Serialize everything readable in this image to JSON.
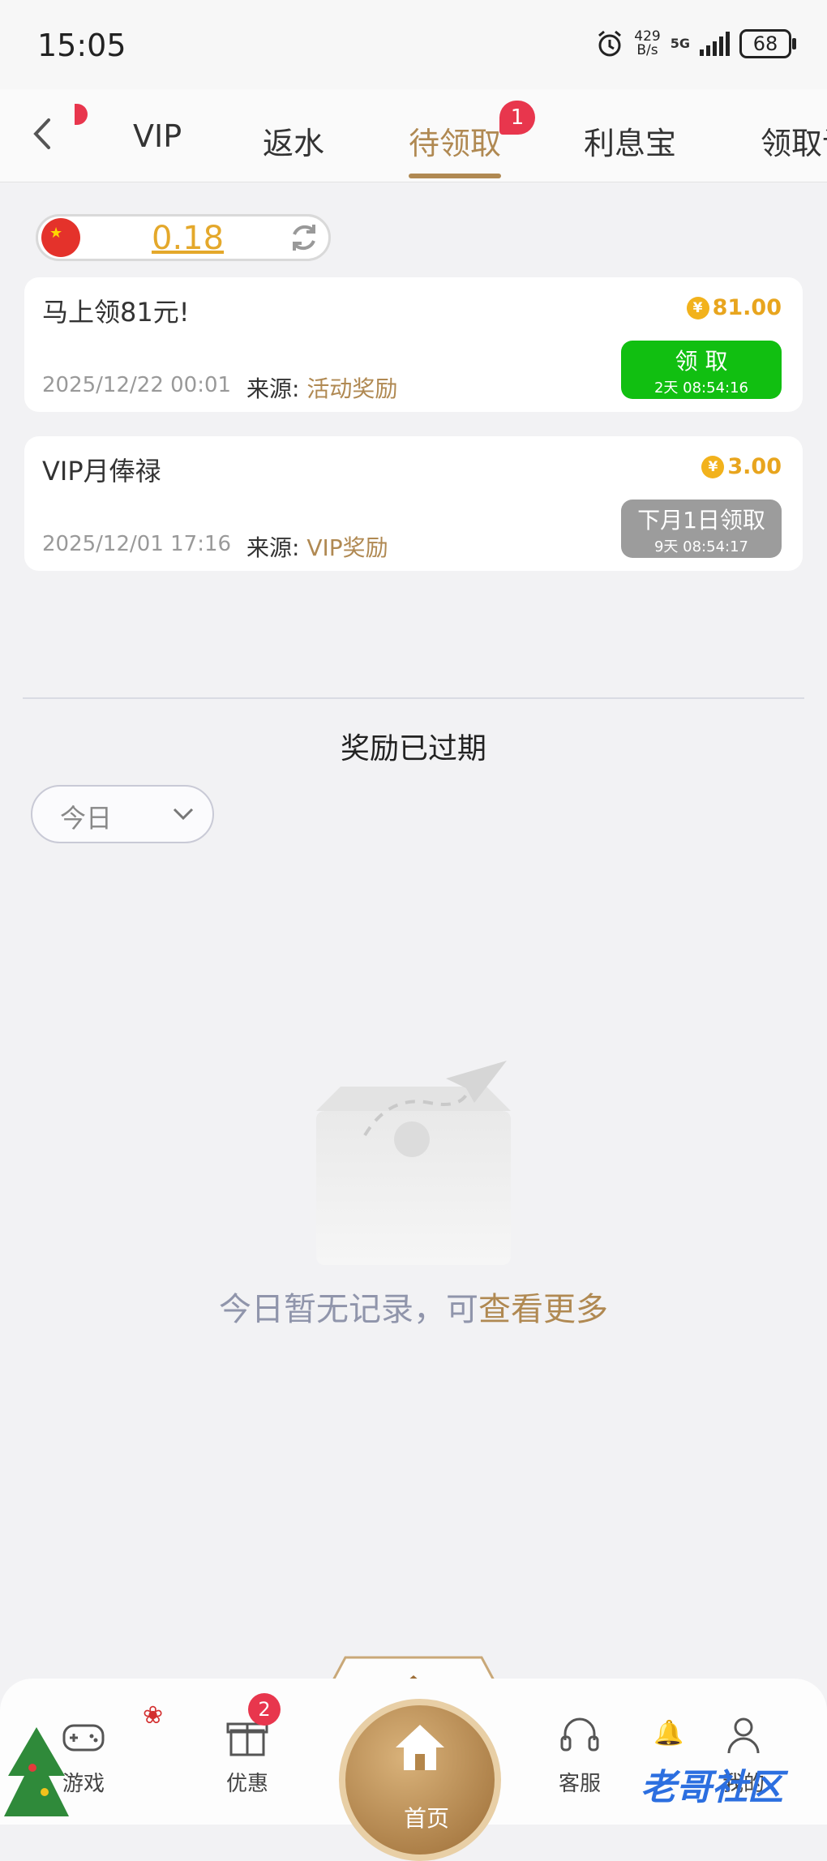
{
  "status_bar": {
    "time": "15:05",
    "net_speed_value": "429",
    "net_speed_unit": "B/s",
    "network": "5G",
    "battery": "68"
  },
  "tabs": [
    {
      "label": "VIP",
      "active": false
    },
    {
      "label": "返水",
      "active": false
    },
    {
      "label": "待领取",
      "active": true,
      "badge": "1"
    },
    {
      "label": "利息宝",
      "active": false
    },
    {
      "label": "领取记",
      "active": false
    }
  ],
  "balance": {
    "value": "0.18"
  },
  "rewards": [
    {
      "title": "马上领81元!",
      "amount": "81.00",
      "currency_symbol": "¥",
      "date": "2025/12/22 00:01",
      "source_label": "来源:",
      "source": "活动奖励",
      "button_label": "领 取",
      "button_sub": "2天 08:54:16",
      "button_color": "#11bf11"
    },
    {
      "title": "VIP月俸禄",
      "amount": "3.00",
      "currency_symbol": "¥",
      "date": "2025/12/01 17:16",
      "source_label": "来源:",
      "source": "VIP奖励",
      "button_label": "下月1日领取",
      "button_sub": "9天 08:54:17",
      "button_color": "#9c9c9c"
    }
  ],
  "expired": {
    "title": "奖励已过期",
    "filter_selected": "今日",
    "empty_text": "今日暂无记录，可",
    "empty_link": "查看更多"
  },
  "bottom_nav": {
    "items": [
      "游戏",
      "优惠",
      "首页",
      "客服",
      "我的"
    ],
    "promo_badge": "2",
    "watermark": "老哥社区"
  },
  "colors": {
    "accent": "#b08952",
    "badge": "#e8364d",
    "claim": "#11bf11",
    "amount": "#e8a51e"
  }
}
